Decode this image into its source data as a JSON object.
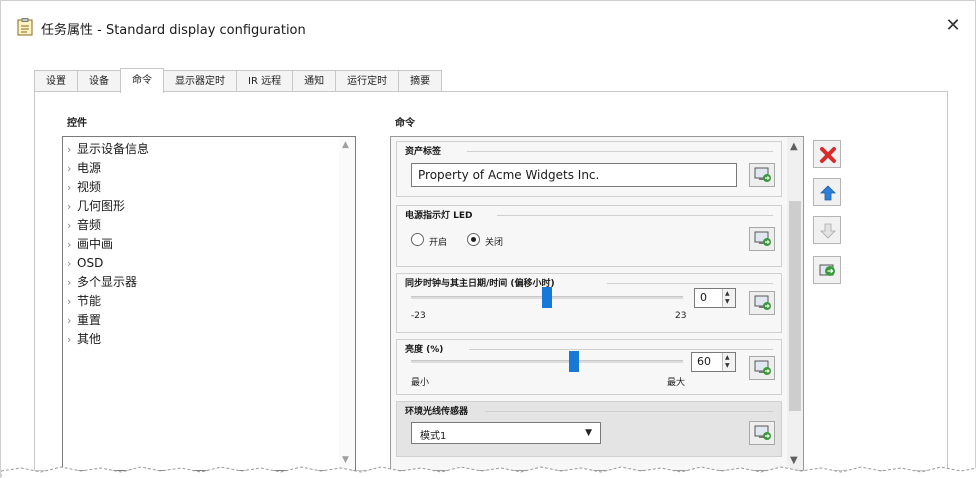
{
  "window": {
    "title": "任务属性 - Standard display configuration",
    "close_label": "✕"
  },
  "tabs": [
    {
      "label": "设置",
      "active": false
    },
    {
      "label": "设备",
      "active": false
    },
    {
      "label": "命令",
      "active": true
    },
    {
      "label": "显示器定时",
      "active": false
    },
    {
      "label": "IR 远程",
      "active": false
    },
    {
      "label": "通知",
      "active": false
    },
    {
      "label": "运行定时",
      "active": false
    },
    {
      "label": "摘要",
      "active": false
    }
  ],
  "controls_group": {
    "title": "控件",
    "items": [
      "显示设备信息",
      "电源",
      "视频",
      "几何图形",
      "音频",
      "画中画",
      "OSD",
      "多个显示器",
      "节能",
      "重置",
      "其他"
    ]
  },
  "commands_group": {
    "title": "命令",
    "asset_tag": {
      "title": "资产标签",
      "value": "Property of Acme Widgets Inc."
    },
    "power_led": {
      "title": "电源指示灯 LED",
      "options": [
        {
          "label": "开启",
          "checked": false
        },
        {
          "label": "关闭",
          "checked": true
        }
      ]
    },
    "clock_sync": {
      "title": "同步时钟与其主日期/时间 (偏移小时)",
      "min_label": "-23",
      "max_label": "23",
      "min": -23,
      "max": 23,
      "value": 0,
      "value_text": "0"
    },
    "brightness": {
      "title": "亮度 (%)",
      "min_label": "最小",
      "max_label": "最大",
      "min": 0,
      "max": 100,
      "value": 60,
      "value_text": "60"
    },
    "ambient_sensor": {
      "title": "环境光线传感器",
      "selected": "模式1"
    }
  },
  "toolbar": {
    "delete_icon": "red-x-icon",
    "move_up_icon": "arrow-up-icon",
    "move_down_icon": "arrow-down-icon",
    "send_all_icon": "send-all-icon"
  },
  "colors": {
    "accent": "#1878d8",
    "delete": "#d92b2b",
    "arrow": "#2f7fd6",
    "send": "#3a9a3a"
  }
}
